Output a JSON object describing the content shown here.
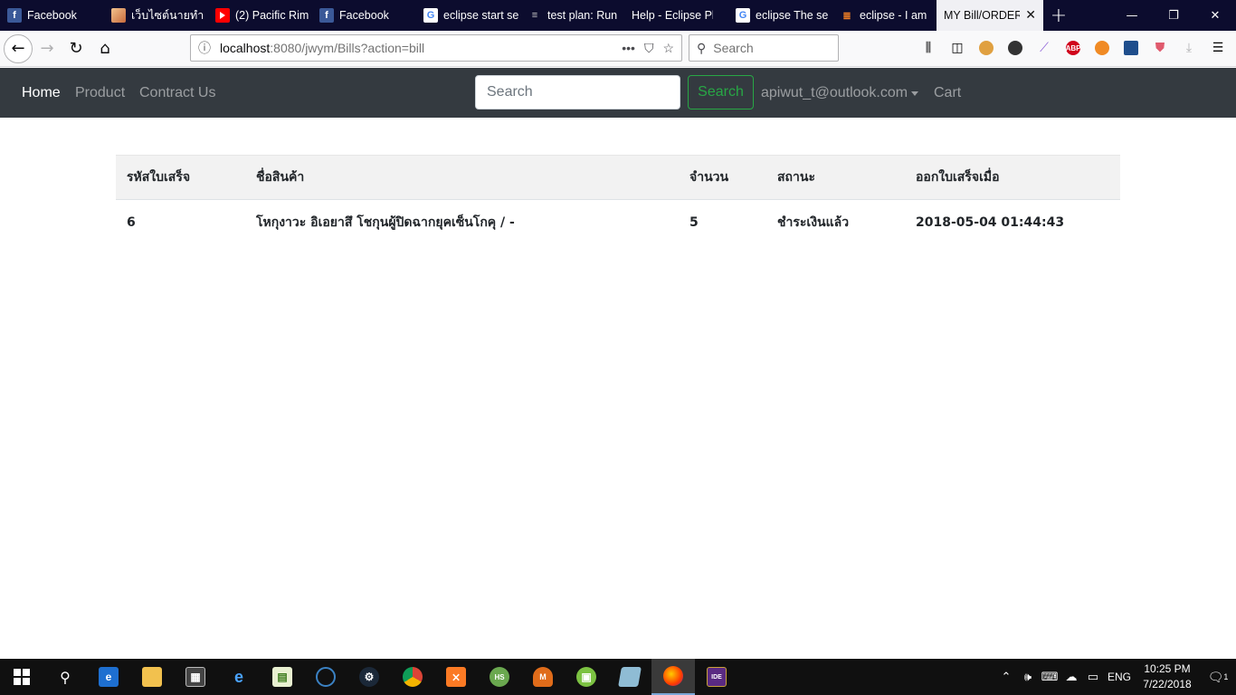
{
  "browser": {
    "tabs": [
      {
        "title": "Facebook",
        "favicon": "facebook-favicon",
        "active": false
      },
      {
        "title": "เว็บไซต์นายทำ",
        "favicon": "image-favicon",
        "active": false
      },
      {
        "title": "(2) Pacific Rim",
        "favicon": "youtube-favicon",
        "active": false
      },
      {
        "title": "Facebook",
        "favicon": "facebook-favicon",
        "active": false
      },
      {
        "title": "eclipse start se",
        "favicon": "google-favicon",
        "active": false
      },
      {
        "title": "test plan: Run",
        "favicon": "testplan-favicon",
        "active": false
      },
      {
        "title": "Help - Eclipse Plat",
        "favicon": "none",
        "active": false
      },
      {
        "title": "eclipse The se",
        "favicon": "google-favicon",
        "active": false
      },
      {
        "title": "eclipse - I am",
        "favicon": "stackoverflow-favicon",
        "active": false
      },
      {
        "title": "MY Bill/ORDER",
        "favicon": "none",
        "active": true
      }
    ],
    "new_tab_label": "+",
    "window_controls": {
      "minimize": "—",
      "restore": "❐",
      "close": "✕"
    },
    "url": {
      "host": "localhost",
      "rest": ":8080/jwym/Bills?action=bill"
    },
    "url_actions": {
      "more": "•••",
      "pocket": "⛉",
      "bookmark": "☆"
    },
    "search_placeholder": "Search"
  },
  "navbar": {
    "links": [
      "Home",
      "Product",
      "Contract Us"
    ],
    "search_placeholder": "Search",
    "search_button": "Search",
    "user_email": "apiwut_t@outlook.com",
    "cart": "Cart"
  },
  "bill_table": {
    "headers": [
      "รหัสใบเสร็จ",
      "ชื่อสินค้า",
      "จำนวน",
      "สถานะ",
      "ออกใบเสร็จเมื่อ"
    ],
    "rows": [
      [
        "6",
        "โหกุงาวะ อิเอยาสึ โชกุนผู้ปิดฉากยุคเซ็นโกคุ / -",
        "5",
        "ชำระเงินแล้ว",
        "2018-05-04 01:44:43"
      ]
    ]
  },
  "taskbar": {
    "language": "ENG",
    "time": "10:25 PM",
    "date": "7/22/2018",
    "notification_count": "1"
  }
}
